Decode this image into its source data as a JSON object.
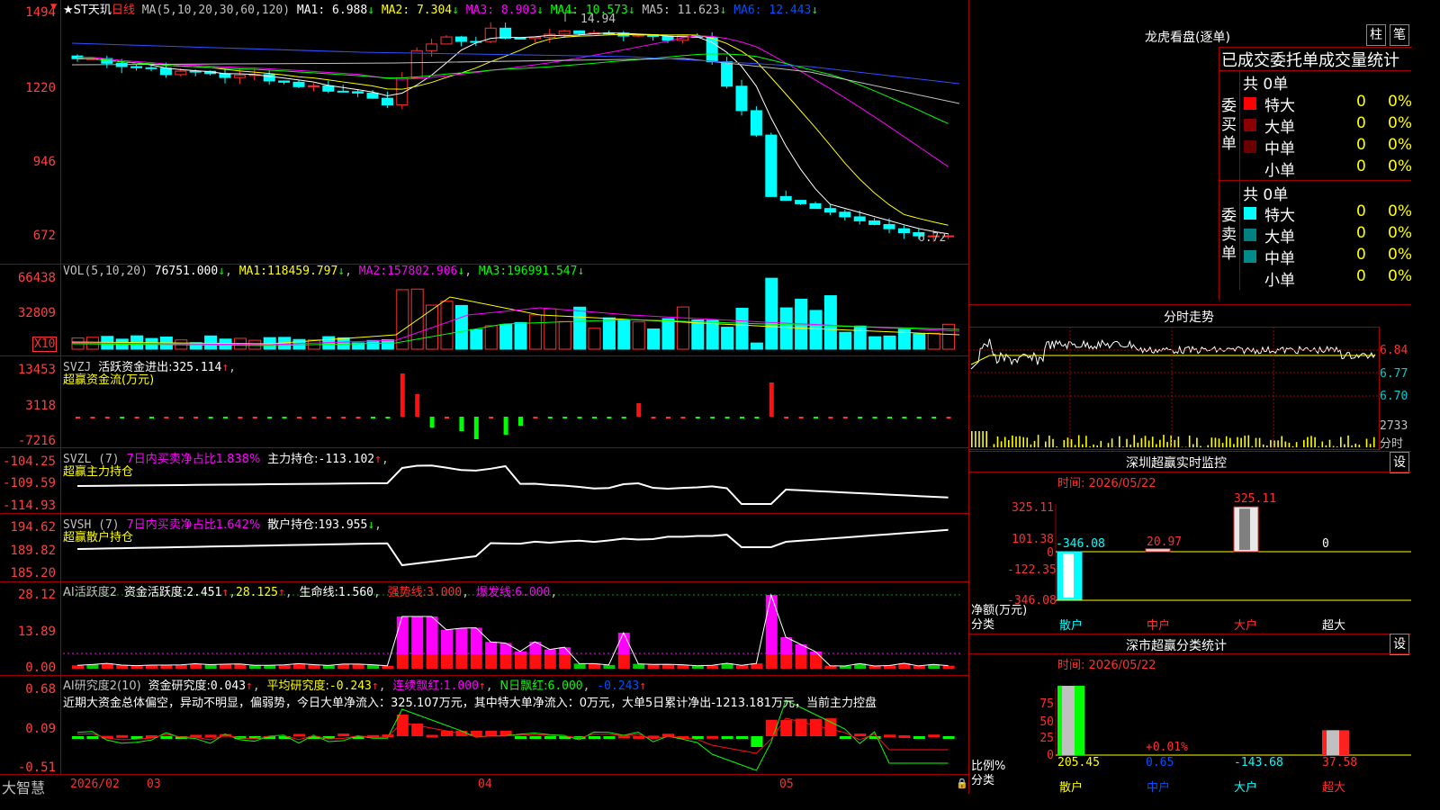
{
  "stock": {
    "name": "★ST天玑",
    "period": "日线"
  },
  "price_panel": {
    "ma_prefix": "MA(5,10,20,30,60,120)",
    "ma": [
      {
        "label": "MA1:",
        "value": "6.988",
        "arrow": "↓",
        "color": "#ffffff"
      },
      {
        "label": "MA2:",
        "value": "7.304",
        "arrow": "↓",
        "color": "#ffff00"
      },
      {
        "label": "MA3:",
        "value": "8.903",
        "arrow": "↓",
        "color": "#ff00ff"
      },
      {
        "label": "MA4:",
        "value": "10.573",
        "arrow": "↓",
        "color": "#00ff00"
      },
      {
        "label": "MA5:",
        "value": "11.623",
        "arrow": "↓",
        "color": "#c0c0c0"
      },
      {
        "label": "MA6:",
        "value": "12.443",
        "arrow": "↓",
        "color": "#0050ff"
      }
    ],
    "y_ticks": [
      "1494",
      "1220",
      "946",
      "672"
    ],
    "high_mark": "14.94",
    "low_mark": "6.72"
  },
  "vol_panel": {
    "title": "VOL(5,10,20)",
    "value": "76751.000",
    "ma": [
      {
        "label": "MA1:",
        "value": "118459.797",
        "color": "#ffff00"
      },
      {
        "label": "MA2:",
        "value": "157802.906",
        "color": "#ff00ff"
      },
      {
        "label": "MA3:",
        "value": "196991.547",
        "color": "#00ff00"
      }
    ],
    "y_ticks": [
      "66438",
      "32809"
    ],
    "unit": "X10"
  },
  "svzj_panel": {
    "title": "SVZJ",
    "label": "活跃资金进出:",
    "value": "325.114",
    "subtitle": "超赢资金流(万元)",
    "y_ticks": [
      "13453",
      "3118",
      "-7216"
    ]
  },
  "svzl_panel": {
    "title": "SVZL (7)",
    "ratio_label": "7日内买卖净占比1.838%",
    "label": "主力持仓:",
    "value": "-113.102",
    "subtitle": "超赢主力持仓",
    "y_ticks": [
      "-104.25",
      "-109.59",
      "-114.93"
    ]
  },
  "svsh_panel": {
    "title": "SVSH (7)",
    "ratio_label": "7日内买卖净占比1.642%",
    "label": "散户持仓:",
    "value": "193.955",
    "subtitle": "超赢散户持仓",
    "y_ticks": [
      "194.62",
      "189.82",
      "185.20"
    ]
  },
  "ai_active_panel": {
    "title": "AI活跃度2",
    "fund_label": "资金活跃度:",
    "fund_value": "2.451",
    "v2": "28.125",
    "life_label": "生命线:",
    "life_value": "1.560",
    "strong_label": "强势线:",
    "strong_value": "3.000",
    "burst_label": "爆发线:",
    "burst_value": "6.000",
    "y_ticks": [
      "28.12",
      "13.89",
      "0.00"
    ]
  },
  "ai_research_panel": {
    "title": "AI研究度2(10)",
    "fund_label": "资金研究度:",
    "fund_value": "0.043",
    "avg_label": "平均研究度:",
    "avg_value": "-0.243",
    "cont_label": "连续飘红:",
    "cont_value": "1.000",
    "n_label": "N日飘红:",
    "n_value": "6.000",
    "last_value": "-0.243",
    "comment": "近期大资金总体偏空，异动不明显，偏弱势，今日大单净流入：325.107万元，其中特大单净流入：0万元，大单5日累计净出-1213.181万元，当前主力控盘",
    "y_ticks": [
      "0.68",
      "0.09",
      "-0.51"
    ]
  },
  "x_axis": {
    "labels": [
      "2026/02",
      "03",
      "04",
      "05"
    ]
  },
  "brand": "大智慧",
  "dragon": {
    "title": "龙虎看盘(逐单)",
    "btn1": "柱",
    "btn2": "笔",
    "stats_header": "已成交委托单成交量统计",
    "buy_side": "委买单",
    "sell_side": "委卖单",
    "buy_total": "共 0单",
    "sell_total": "共 0单",
    "rows": [
      {
        "label": "特大",
        "count": "0",
        "pct": "0%"
      },
      {
        "label": "大单",
        "count": "0",
        "pct": "0%"
      },
      {
        "label": "中单",
        "count": "0",
        "pct": "0%"
      },
      {
        "label": "小单",
        "count": "0",
        "pct": "0%"
      }
    ],
    "buy_colors": [
      "#ff0000",
      "#8b0000",
      "#6b0000",
      "#000000"
    ],
    "sell_colors": [
      "#00ffff",
      "#008080",
      "#008b8b",
      "#000000"
    ]
  },
  "intraday": {
    "title": "分时走势",
    "y_ticks": [
      "6.84",
      "6.77",
      "6.70"
    ],
    "vol_tick": "2733",
    "vol_unit": "分时"
  },
  "sz_monitor": {
    "title": "深圳超赢实时监控",
    "setting": "设",
    "time_label": "时间: 2026/05/22",
    "y_ticks": [
      "325.11",
      "101.38",
      "0",
      "-122.35",
      "-346.08"
    ],
    "bars": [
      {
        "cat": "散户",
        "value": "-346.08",
        "num": -346.08
      },
      {
        "cat": "中户",
        "value": "20.97",
        "num": 20.97
      },
      {
        "cat": "大户",
        "value": "325.11",
        "num": 325.11
      },
      {
        "cat": "超大",
        "value": "0",
        "num": 0
      }
    ],
    "net_label": "净额(万元)",
    "cat_label": "分类"
  },
  "sz_class": {
    "title": "深市超赢分类统计",
    "setting": "设",
    "time_label": "时间: 2026/05/22",
    "y_ticks": [
      "75",
      "50",
      "25",
      "0"
    ],
    "mid_pct": "+0.01%",
    "bars": [
      {
        "cat": "散户",
        "value": "205.45",
        "pct": 78
      },
      {
        "cat": "中户",
        "value": "0.65",
        "pct": 0.01
      },
      {
        "cat": "大户",
        "value": "-143.68",
        "pct": 0
      },
      {
        "cat": "超大",
        "value": "37.58",
        "pct": 28
      }
    ],
    "ratio_label": "比例%",
    "cat_label": "分类"
  }
}
